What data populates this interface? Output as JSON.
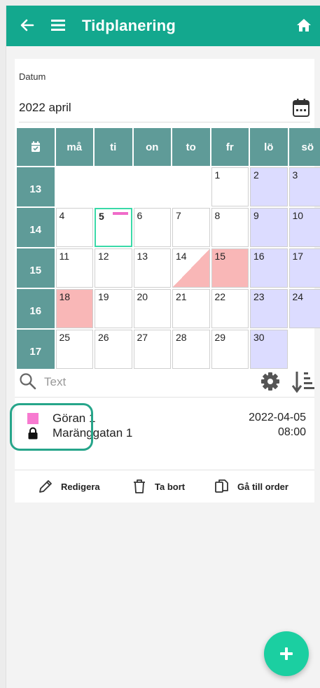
{
  "header": {
    "title": "Tidplanering"
  },
  "date_field": {
    "label": "Datum",
    "value": "2022 april"
  },
  "calendar": {
    "weekdays": [
      "må",
      "ti",
      "on",
      "to",
      "fr",
      "lö",
      "sö"
    ],
    "weeks": [
      {
        "number": "13",
        "days": [
          "",
          "",
          "",
          "",
          "1",
          "2",
          "3"
        ]
      },
      {
        "number": "14",
        "days": [
          "4",
          "5",
          "6",
          "7",
          "8",
          "9",
          "10"
        ]
      },
      {
        "number": "15",
        "days": [
          "11",
          "12",
          "13",
          "14",
          "15",
          "16",
          "17"
        ]
      },
      {
        "number": "16",
        "days": [
          "18",
          "19",
          "20",
          "21",
          "22",
          "23",
          "24"
        ]
      },
      {
        "number": "17",
        "days": [
          "25",
          "26",
          "27",
          "28",
          "29",
          "30",
          ""
        ]
      }
    ],
    "today": "5",
    "red_days": [
      "15",
      "18"
    ],
    "half_red_days": [
      "14"
    ],
    "marked_days": [
      "5"
    ]
  },
  "search": {
    "placeholder": "Text"
  },
  "order": {
    "name": "Göran 1",
    "address": "Maränggatan 1",
    "date": "2022-04-05",
    "time": "08:00",
    "color": "#f77ad0"
  },
  "actions": {
    "edit": "Redigera",
    "delete": "Ta bort",
    "goto": "Gå till order"
  },
  "colors": {
    "appbar": "#13a88e",
    "calendar_header": "#5f9b98",
    "weekend": "#dcdcff",
    "booked": "#f9b7b7",
    "today_border": "#3ad9a8",
    "fab": "#1bcfa1"
  }
}
